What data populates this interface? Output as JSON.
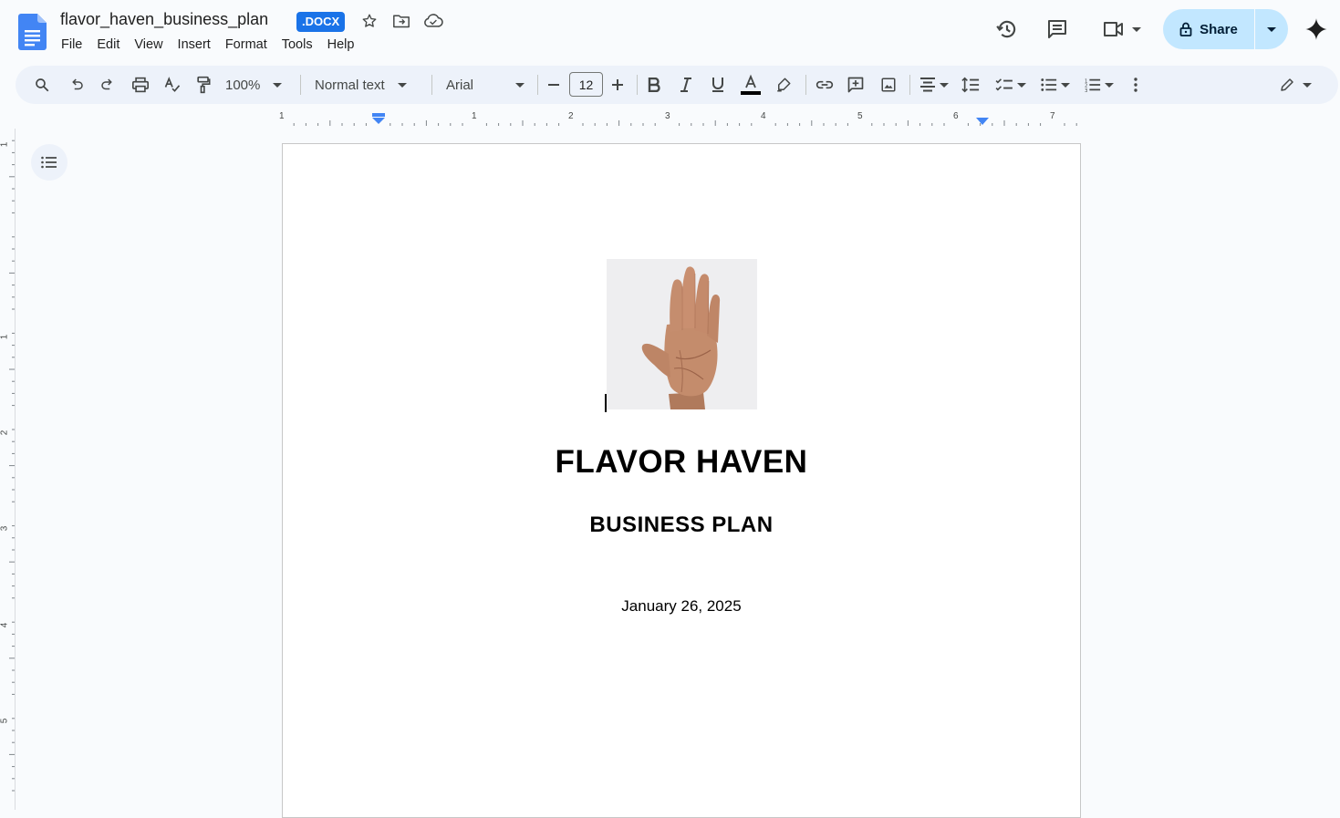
{
  "header": {
    "doc_title": "flavor_haven_business_plan",
    "badge": ".DOCX",
    "menu": [
      "File",
      "Edit",
      "View",
      "Insert",
      "Format",
      "Tools",
      "Help"
    ],
    "share_label": "Share"
  },
  "toolbar": {
    "zoom": "100%",
    "style": "Normal text",
    "font": "Arial",
    "font_size": "12"
  },
  "ruler": {
    "labels": [
      "1",
      "1",
      "2",
      "3",
      "4",
      "5",
      "6",
      "7"
    ],
    "vertical_labels": [
      "1",
      "1",
      "2",
      "3",
      "4",
      "5"
    ]
  },
  "document": {
    "title": "FLAVOR HAVEN",
    "subtitle": "BUSINESS PLAN",
    "date": "January 26, 2025",
    "image_alt": "raised-hand-photo"
  },
  "colors": {
    "accent": "#1a73e8",
    "share_bg": "#c2e7ff",
    "toolbar_bg": "#edf2fa"
  }
}
